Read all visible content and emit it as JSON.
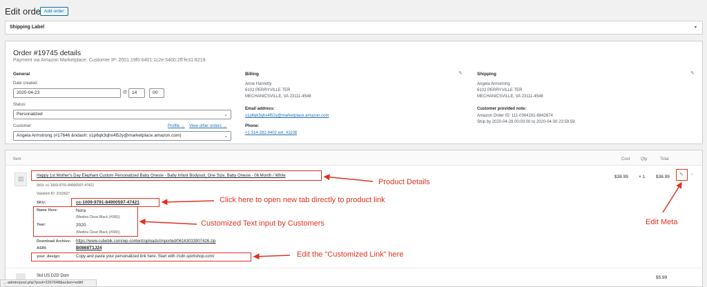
{
  "header": {
    "title": "Edit order",
    "add_order_label": "Add order"
  },
  "shipping_label": {
    "title": "Shipping Label",
    "toggle": "▾"
  },
  "order": {
    "title": "Order #19745 details",
    "subtitle": "Payment via Amazon Marketplace. Customer IP: 2001:19f0:6401:1c2e:5400:2ff:fe31:8219",
    "general": {
      "heading": "General",
      "date_label": "Date created:",
      "date_value": "2020-04-23",
      "at": "@",
      "hour": "14",
      "minute": "00",
      "status_label": "Status:",
      "status_value": "Personalized",
      "customer_label": "Customer:",
      "profile_link": "Profile →",
      "other_orders_link": "View other orders →",
      "customer_value": "Angela Armstrong (#17646 &ndash; s1p6qk3qhx4l52y@marketplace.amazon.com)"
    },
    "billing": {
      "heading": "Billing",
      "line1": "Anne Hanretty",
      "line2": "6102 PERRYVILLE TER",
      "line3": "MECHANICSVILLE, VA 23111-4548",
      "email_label": "Email address:",
      "email": "s1p6qk3qhx4l52y@marketplace.amazon.com",
      "phone_label": "Phone:",
      "phone": "+1 314-282-9402 ext. 41108"
    },
    "shipping": {
      "heading": "Shipping",
      "line1": "Angela Armstrong",
      "line2": "6102 PERRYVILLE TER",
      "line3": "MECHANICSVILLE, VA 23111-4548",
      "note_label": "Customer provided note:",
      "note1": "Amazon Order ID: 111-0364161-6842674",
      "note2": "Ship by 2020-04-29 00:00:00 to 2020-04-30 23:59:59"
    }
  },
  "items": {
    "col_item": "Item",
    "col_cost": "Cost",
    "col_qty": "Qty",
    "col_total": "Total",
    "row1": {
      "title": "Happy 1st Mother's Day Elephant Custom Personalized Baby Onesie - Baby Infant Bodysuit, One Size, Baby Onesie - 06 Month / White",
      "sku_line": "SKU: cc-1009-9791-84900597-47421",
      "variation": "Variation ID: 2162627",
      "sku_label": "SKU:",
      "sku_value": "cc-1009-9791-84900597-47421",
      "name_label": "Name Here:",
      "name_value": "Nora",
      "name_font": "(Medina Clean Black (#000))",
      "year_label": "Year:",
      "year_value": "2020",
      "year_font": "(Medina Clean Black (#000))",
      "download_label": "Download Archive:",
      "download_value": "https://www.cubebik.com/wp-content/uploads/imported/06163033907426.zip",
      "asin_label": "ASIN:",
      "asin_value": "B0868T1J24",
      "design_label": "your_design:",
      "design_value": "Copy and paste your personalized link here. Start with //cdn.spiritshop.com/",
      "cost": "$38.99",
      "qty": "× 1",
      "total": "$38.99"
    },
    "row2": {
      "title": "Std US D2D Dom",
      "total": "$5.99"
    }
  },
  "annotations": {
    "product_details": "Product Details",
    "click_here": "Click here to open new tab directly to product link",
    "customized": "Customized Text input by Customers",
    "edit_meta": "Edit Meta",
    "edit_link": "Edit the \"Customized Link\" here"
  },
  "status_bar": "…-admin/post.php?post=2267648&action=edit#",
  "colors": {
    "accent": "#2271b1",
    "annotation": "#e0321e"
  }
}
